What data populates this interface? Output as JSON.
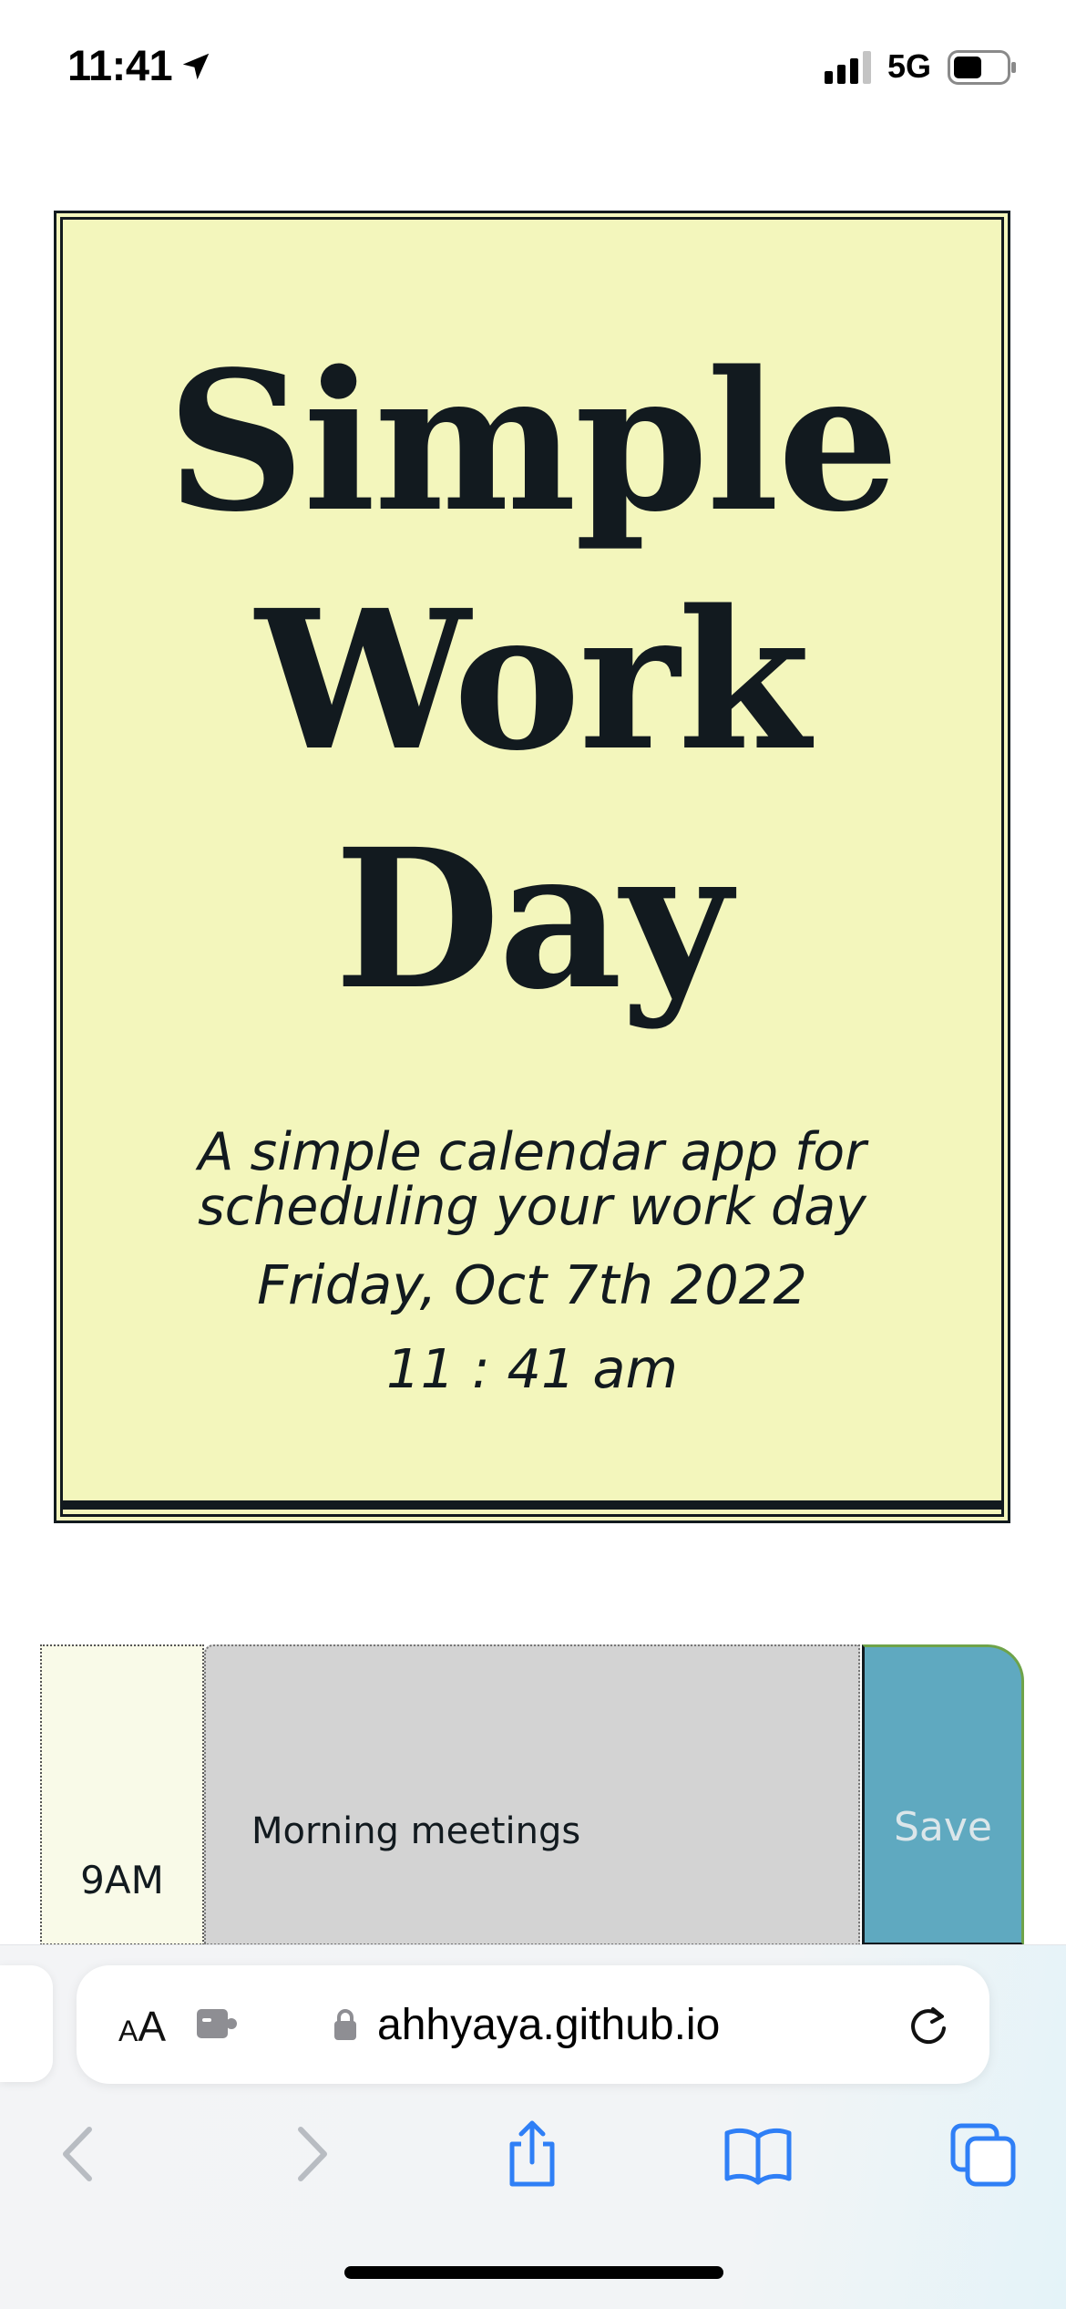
{
  "status_bar": {
    "time": "11:41",
    "network": "5G",
    "icons": [
      "location-arrow-icon",
      "signal-bars-icon",
      "battery-icon"
    ]
  },
  "header": {
    "title_lines": [
      "Simple",
      "Work",
      "Day"
    ],
    "subtitle_lines": [
      "A simple calendar app for",
      "scheduling your work day"
    ],
    "date": "Friday, Oct 7th 2022",
    "time": "11 : 41 am",
    "colors": {
      "card_background": "#f3f6bc",
      "ink": "#121a1f"
    }
  },
  "schedule": {
    "rows": [
      {
        "hour": "9AM",
        "event": "Morning meetings",
        "save_label": "Save"
      }
    ],
    "colors": {
      "hour_cell": "#f9fae8",
      "event_field": "#d3d3d3",
      "save_button": "#5fa9c0"
    }
  },
  "browser": {
    "reader_small": "A",
    "reader_big": "A",
    "url": "ahhyaya.github.io",
    "toolbar_icons": [
      "back-chevron-icon",
      "forward-chevron-icon",
      "share-icon",
      "bookmarks-icon",
      "tabs-icon"
    ],
    "accent": "#2f7ff6"
  }
}
